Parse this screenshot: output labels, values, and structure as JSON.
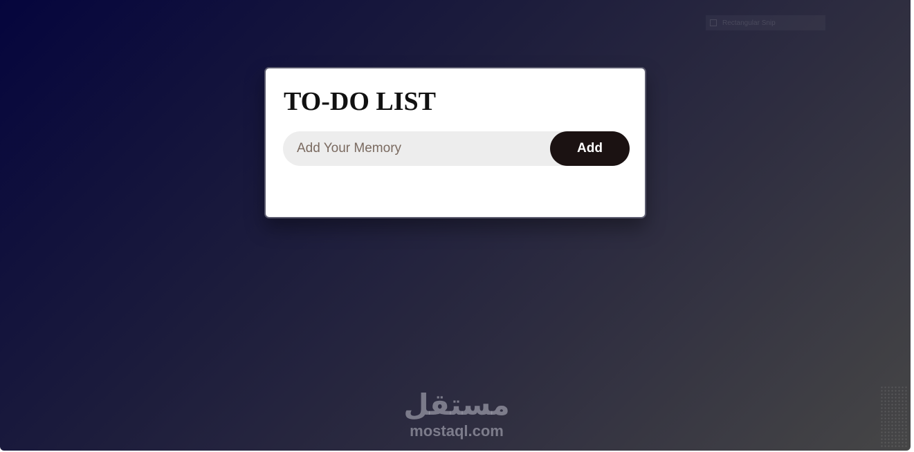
{
  "app": {
    "title": "TO-DO LIST"
  },
  "form": {
    "input_placeholder": "Add Your Memory",
    "input_value": "",
    "add_label": "Add"
  },
  "overlay": {
    "snip_label": "Rectangular Snip"
  },
  "watermark": {
    "arabic": "مستقل",
    "latin": "mostaql.com"
  },
  "colors": {
    "background_start": "#05053d",
    "background_end": "#464646",
    "card": "#ffffff",
    "input_background": "#ededed",
    "button": "#1b1212",
    "button_text": "#ffffff"
  }
}
